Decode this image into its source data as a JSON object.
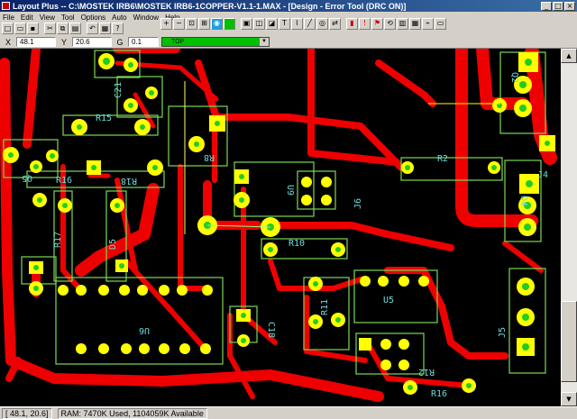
{
  "window": {
    "title": "Layout Plus -- C:\\MOSTEK IRB6\\MOSTEK IRB6-1COPPER-V1.1-1.MAX - [Design - Error Tool (DRC ON)]",
    "min": "_",
    "max": "□",
    "close": "×"
  },
  "menu": [
    "File",
    "Edit",
    "View",
    "Tool",
    "Options",
    "Auto",
    "Window",
    "Help"
  ],
  "coords": {
    "x_label": "X",
    "x_value": "48.1",
    "y_label": "Y",
    "y_value": "20.6",
    "g_label": "G",
    "g_value": "0.1",
    "layer": "TOP"
  },
  "components": [
    {
      "ref": "C21"
    },
    {
      "ref": "R15"
    },
    {
      "ref": "R8"
    },
    {
      "ref": "Q5"
    },
    {
      "ref": "R16"
    },
    {
      "ref": "R18"
    },
    {
      "ref": "U9"
    },
    {
      "ref": "J6"
    },
    {
      "ref": "R2"
    },
    {
      "ref": "Q2"
    },
    {
      "ref": "J4"
    },
    {
      "ref": "Q4"
    },
    {
      "ref": "R17"
    },
    {
      "ref": "D5"
    },
    {
      "ref": "R10"
    },
    {
      "ref": "U5"
    },
    {
      "ref": "R11"
    },
    {
      "ref": "U6"
    },
    {
      "ref": "C18"
    },
    {
      "ref": "J5"
    },
    {
      "ref": "R12"
    },
    {
      "ref": "R16"
    }
  ],
  "status": {
    "coords": "[ 48.1, 20.6]",
    "memory": "RAM: 7470K Used, 1104059K Available"
  },
  "colors": {
    "board": "#000000",
    "copper_top": "#ee0000",
    "pad": "#ffff00",
    "silkscreen": "#7cd957",
    "refdes": "#6fdcdc"
  }
}
